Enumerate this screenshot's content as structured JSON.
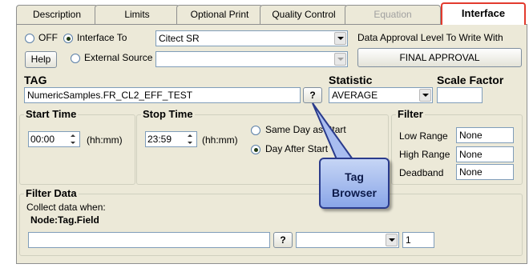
{
  "tabs": [
    {
      "label": "Description",
      "state": "normal"
    },
    {
      "label": "Limits",
      "state": "normal"
    },
    {
      "label": "Optional Print",
      "state": "normal"
    },
    {
      "label": "Quality Control",
      "state": "normal"
    },
    {
      "label": "Equation",
      "state": "disabled"
    },
    {
      "label": "Interface",
      "state": "active"
    }
  ],
  "source": {
    "off_label": "OFF",
    "interface_to_label": "Interface To",
    "interface_to_value": "Citect SR",
    "help_label": "Help",
    "external_source_label": "External Source",
    "external_source_value": "",
    "selected": "interface_to"
  },
  "approval": {
    "label": "Data Approval Level To Write With",
    "button_label": "FINAL APPROVAL"
  },
  "tag": {
    "label": "TAG",
    "value": "NumericSamples.FR_CL2_EFF_TEST",
    "browse_label": "?"
  },
  "statistic": {
    "label": "Statistic",
    "value": "AVERAGE"
  },
  "scale_factor": {
    "label": "Scale Factor",
    "value": ""
  },
  "start_time": {
    "label": "Start Time",
    "value": "00:00",
    "unit": "(hh:mm)"
  },
  "stop_time": {
    "label": "Stop Time",
    "value": "23:59",
    "unit": "(hh:mm)",
    "same_day_label": "Same Day as Start",
    "day_after_label": "Day After Start",
    "selected": "day_after"
  },
  "filter": {
    "label": "Filter",
    "low_range_label": "Low Range",
    "low_range_value": "None",
    "high_range_label": "High Range",
    "high_range_value": "None",
    "deadband_label": "Deadband",
    "deadband_value": "None"
  },
  "filter_data": {
    "label": "Filter Data",
    "collect_label": "Collect data when:",
    "node_label": "Node:Tag.Field",
    "node_value": "",
    "browse_label": "?",
    "operator_value": "",
    "compare_value": "1"
  },
  "callout": {
    "line1": "Tag",
    "line2": "Browser"
  },
  "colors": {
    "window_bg": "#ece9d8",
    "active_tab_border": "#e33b2e",
    "callout_fill": "#a9bdf0",
    "callout_border": "#2a3b8c"
  }
}
